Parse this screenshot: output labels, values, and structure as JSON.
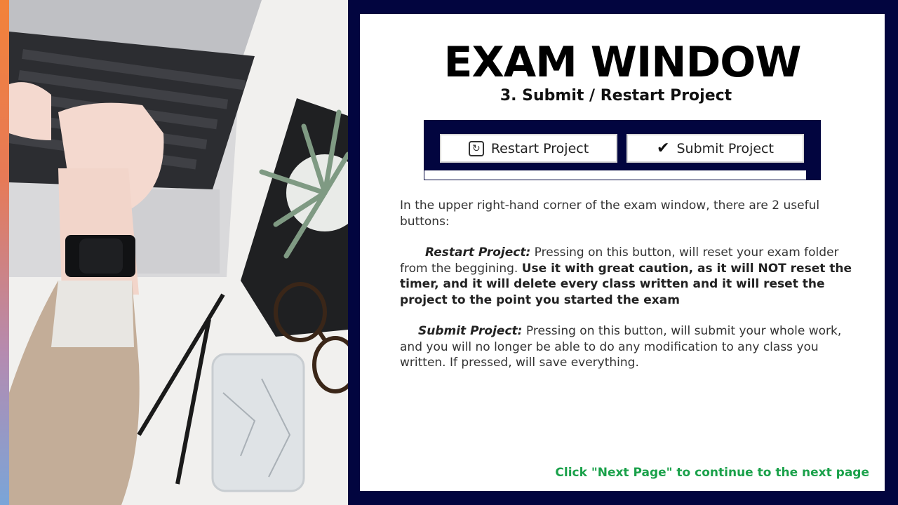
{
  "slide": {
    "title": "EXAM WINDOW",
    "subtitle": "3. Submit / Restart Project",
    "buttons": {
      "restart_label": "Restart Project",
      "submit_label": "Submit Project"
    },
    "intro": "In the upper right-hand corner of the exam window, there are 2 useful buttons:",
    "restart": {
      "label": "Restart Project:",
      "text": " Pressing on this button, will reset your exam folder from the beggining. ",
      "warning": "Use it with great caution, as it will NOT reset the timer, and it will delete every class written and it will reset the project to the point you started the exam"
    },
    "submit": {
      "label": "Submit Project:",
      "text": " Pressing on this button, will submit your whole work, and you will no longer be able to do any modification to any class you written. If pressed, will save everything."
    },
    "footer": "Click \"Next Page\" to continue to the next page"
  },
  "colors": {
    "background": "#02053f",
    "panel": "#ffffff",
    "footer_text": "#1aa14a"
  },
  "icons": [
    "restart-icon",
    "checkmark-icon"
  ]
}
